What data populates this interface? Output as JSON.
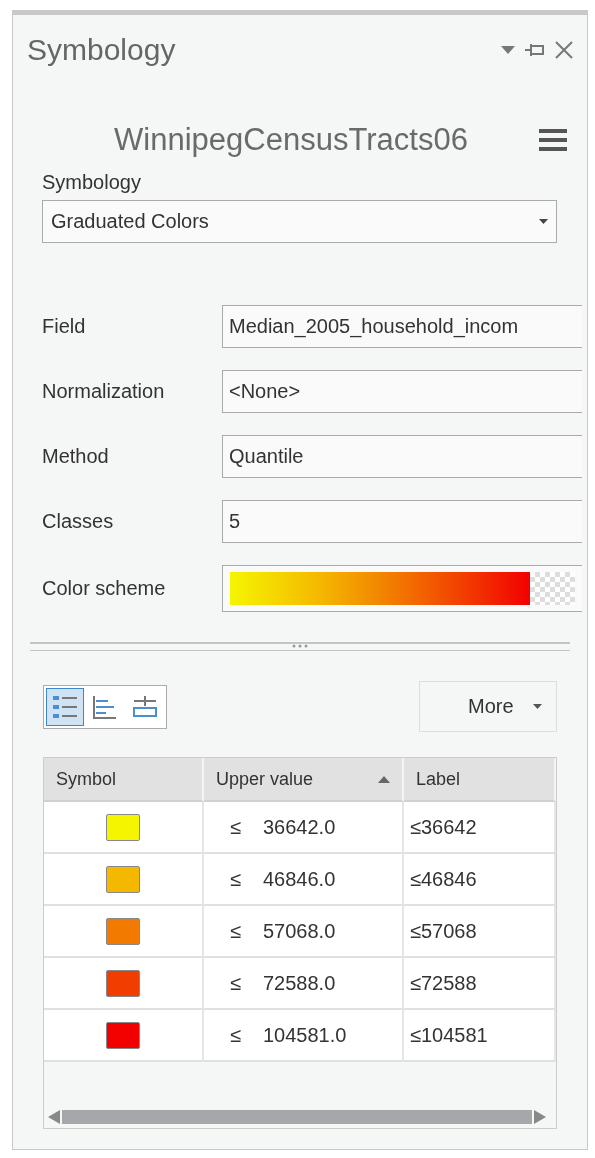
{
  "pane": {
    "title": "Symbology"
  },
  "layer_name": "WinnipegCensusTracts06",
  "primary_symbology": {
    "label": "Symbology",
    "value": "Graduated Colors"
  },
  "fields": [
    {
      "kind": "text",
      "label": "Field",
      "value": "Median_2005_household_incom"
    },
    {
      "kind": "text",
      "label": "Normalization",
      "value": "<None>"
    },
    {
      "kind": "text",
      "label": "Method",
      "value": "Quantile"
    },
    {
      "kind": "text",
      "label": "Classes",
      "value": "5"
    },
    {
      "kind": "ramp",
      "label": "Color scheme"
    }
  ],
  "view_buttons": [
    {
      "kind": "classes",
      "selected": true
    },
    {
      "kind": "histogram",
      "selected": false
    },
    {
      "kind": "advanced",
      "selected": false
    }
  ],
  "more_button": "More",
  "table": {
    "columns": [
      "Symbol",
      "Upper value",
      "Label"
    ],
    "rows": [
      {
        "color": "#f5f500",
        "op": "≤",
        "upper": "36642.0",
        "label": "≤36642"
      },
      {
        "color": "#f5b800",
        "op": "≤",
        "upper": "46846.0",
        "label": "≤46846"
      },
      {
        "color": "#f27a00",
        "op": "≤",
        "upper": "57068.0",
        "label": "≤57068"
      },
      {
        "color": "#f23d00",
        "op": "≤",
        "upper": "72588.0",
        "label": "≤72588"
      },
      {
        "color": "#f20000",
        "op": "≤",
        "upper": "104581.0",
        "label": "≤104581"
      }
    ]
  }
}
